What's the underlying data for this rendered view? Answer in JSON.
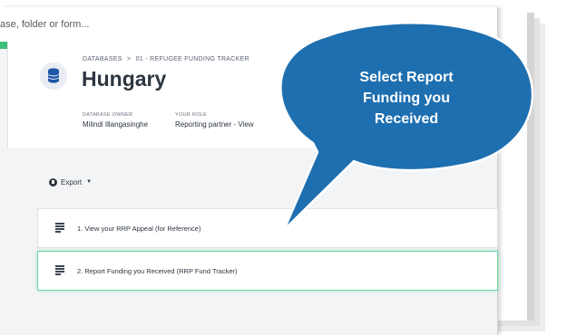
{
  "search": {
    "placeholder": "ase, folder or form..."
  },
  "breadcrumb": {
    "root": "DATABASES",
    "separator": ">",
    "current": "01 - REFUGEE FUNDING TRACKER"
  },
  "database": {
    "title": "Hungary",
    "icon": "database-icon"
  },
  "meta": {
    "owner_label": "DATABASE OWNER",
    "owner_value": "Milindi Illangasinghe",
    "role_label": "YOUR ROLE",
    "role_value": "Reporting partner - View"
  },
  "toolbar": {
    "export_label": "Export",
    "export_caret": "▼"
  },
  "forms": [
    {
      "label": "1. View your RRP Appeal (for Reference)"
    },
    {
      "label": "2. Report Funding you Received (RRP Fund Tracker)"
    }
  ],
  "callout": {
    "line1": "Select Report",
    "line2": "Funding you",
    "line3": "Received"
  },
  "colors": {
    "accent": "#3dbf7c",
    "callout_fill": "#1e6fb0",
    "callout_border": "#ffffff"
  }
}
